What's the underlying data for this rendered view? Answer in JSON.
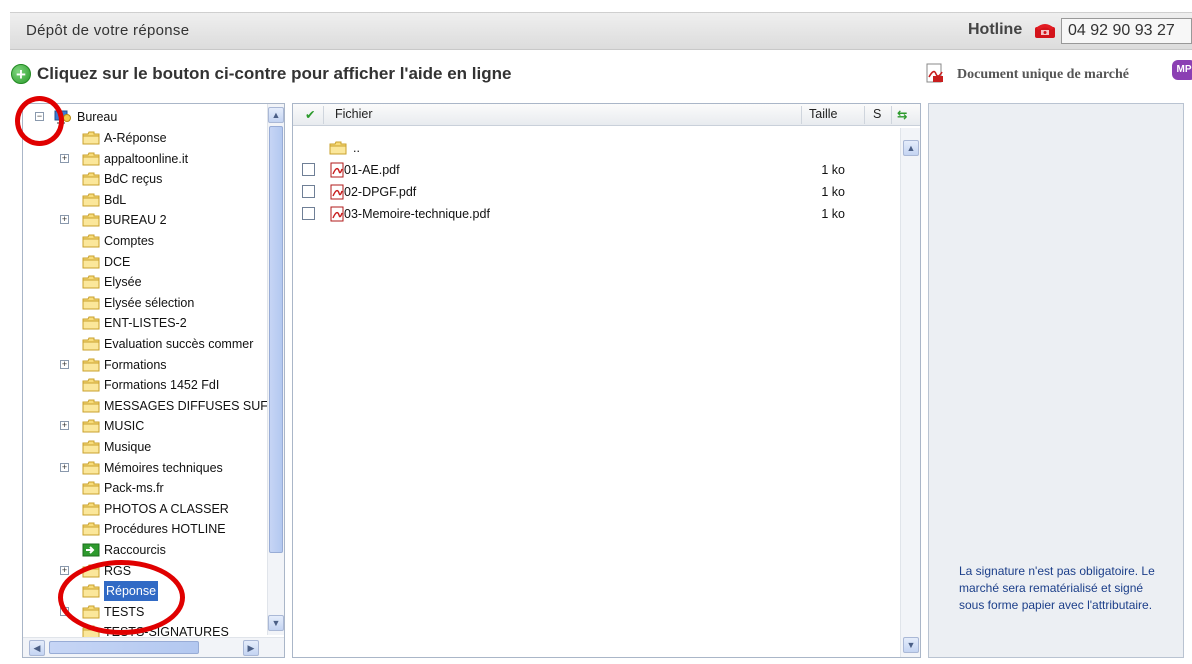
{
  "header": {
    "title": "Dépôt de votre réponse",
    "hotline_label": "Hotline",
    "hotline_number": "04 92 90 93 27"
  },
  "help": {
    "text": "Cliquez sur le bouton ci-contre pour afficher l'aide en ligne"
  },
  "doc_unique": {
    "label": "Document unique de marché",
    "badge": "MP"
  },
  "tree": {
    "root": "Bureau",
    "items": [
      {
        "label": "A-Réponse",
        "expander": false,
        "icon": "folder"
      },
      {
        "label": "appaltoonline.it",
        "expander": true,
        "icon": "folder"
      },
      {
        "label": "BdC reçus",
        "expander": false,
        "icon": "folder"
      },
      {
        "label": "BdL",
        "expander": false,
        "icon": "folder"
      },
      {
        "label": "BUREAU 2",
        "expander": true,
        "icon": "folder"
      },
      {
        "label": "Comptes",
        "expander": false,
        "icon": "folder"
      },
      {
        "label": "DCE",
        "expander": false,
        "icon": "folder"
      },
      {
        "label": "Elysée",
        "expander": false,
        "icon": "folder"
      },
      {
        "label": "Elysée sélection",
        "expander": false,
        "icon": "folder"
      },
      {
        "label": "ENT-LISTES-2",
        "expander": false,
        "icon": "folder"
      },
      {
        "label": "Evaluation succès commer",
        "expander": false,
        "icon": "folder"
      },
      {
        "label": "Formations",
        "expander": true,
        "icon": "folder"
      },
      {
        "label": "Formations 1452 FdI",
        "expander": false,
        "icon": "folder"
      },
      {
        "label": "MESSAGES DIFFUSES SUF",
        "expander": false,
        "icon": "folder"
      },
      {
        "label": "MUSIC",
        "expander": true,
        "icon": "folder"
      },
      {
        "label": "Musique",
        "expander": false,
        "icon": "folder"
      },
      {
        "label": "Mémoires techniques",
        "expander": true,
        "icon": "folder"
      },
      {
        "label": "Pack-ms.fr",
        "expander": false,
        "icon": "folder"
      },
      {
        "label": "PHOTOS A CLASSER",
        "expander": false,
        "icon": "folder"
      },
      {
        "label": "Procédures HOTLINE",
        "expander": false,
        "icon": "folder"
      },
      {
        "label": "Raccourcis",
        "expander": false,
        "icon": "shortcut"
      },
      {
        "label": "RGS",
        "expander": true,
        "icon": "folder"
      },
      {
        "label": "Réponse",
        "expander": false,
        "icon": "folder",
        "selected": true
      },
      {
        "label": "TESTS",
        "expander": true,
        "icon": "folder"
      },
      {
        "label": "TESTS-SIGNATURES",
        "expander": false,
        "icon": "folder"
      }
    ]
  },
  "files": {
    "columns": {
      "name": "Fichier",
      "size": "Taille",
      "s": "S"
    },
    "parent": "..",
    "rows": [
      {
        "name": "01-AE.pdf",
        "size": "1 ko"
      },
      {
        "name": "02-DPGF.pdf",
        "size": "1 ko"
      },
      {
        "name": "03-Memoire-technique.pdf",
        "size": "1 ko"
      }
    ]
  },
  "info": {
    "text": "La signature n'est pas obligatoire. Le marché sera rematérialisé et signé sous forme papier avec l'attributaire."
  },
  "colors": {
    "selection": "#316ac5",
    "annotation_red": "#e00000",
    "info_text": "#1c3f8a"
  }
}
